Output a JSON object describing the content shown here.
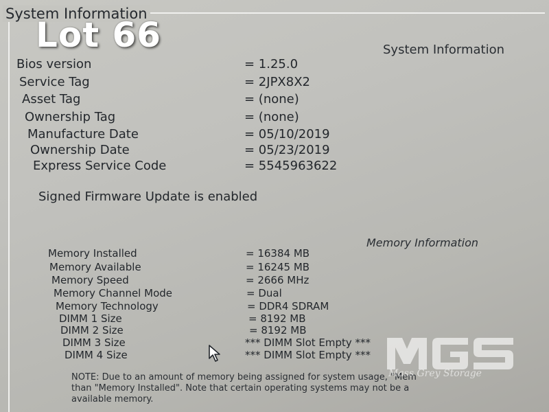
{
  "overlay": {
    "lot_label": "Lot 66"
  },
  "section_title": "System Information",
  "system_heading": "System Information",
  "system_info": [
    {
      "label": "Bios version",
      "value": "= 1.25.0"
    },
    {
      "label": "Service Tag",
      "value": "= 2JPX8X2"
    },
    {
      "label": "Asset Tag",
      "value": "= (none)"
    },
    {
      "label": "Ownership Tag",
      "value": "= (none)"
    },
    {
      "label": "Manufacture Date",
      "value": "= 05/10/2019"
    },
    {
      "label": "Ownership Date",
      "value": "= 05/23/2019"
    },
    {
      "label": "Express Service Code",
      "value": "= 5545963622"
    }
  ],
  "firmware_notice": "Signed Firmware Update is enabled",
  "memory_heading": "Memory Information",
  "memory_info": [
    {
      "label": "Memory Installed",
      "value": "= 16384 MB"
    },
    {
      "label": "Memory Available",
      "value": "= 16245 MB"
    },
    {
      "label": "Memory Speed",
      "value": "= 2666 MHz"
    },
    {
      "label": "Memory Channel Mode",
      "value": "= Dual"
    },
    {
      "label": "Memory Technology",
      "value": "= DDR4 SDRAM"
    },
    {
      "label": "DIMM 1 Size",
      "value": "= 8192 MB"
    },
    {
      "label": "DIMM 2 Size",
      "value": "= 8192 MB"
    },
    {
      "label": "DIMM 3 Size",
      "value": "*** DIMM Slot Empty ***"
    },
    {
      "label": "DIMM 4 Size",
      "value": "*** DIMM Slot Empty ***"
    }
  ],
  "memory_note": {
    "line1": "NOTE: Due to an amount of memory being assigned for system usage, \"Mem",
    "line2": "than \"Memory Installed\". Note that certain operating systems may not be a",
    "line3": "available memory."
  },
  "watermark": {
    "logo": "MGS",
    "tagline": "Mass Grey Storage"
  },
  "colors": {
    "screen_background": "#c1c1bd",
    "text": "#23272c",
    "overlay_text": "#ffffff"
  }
}
